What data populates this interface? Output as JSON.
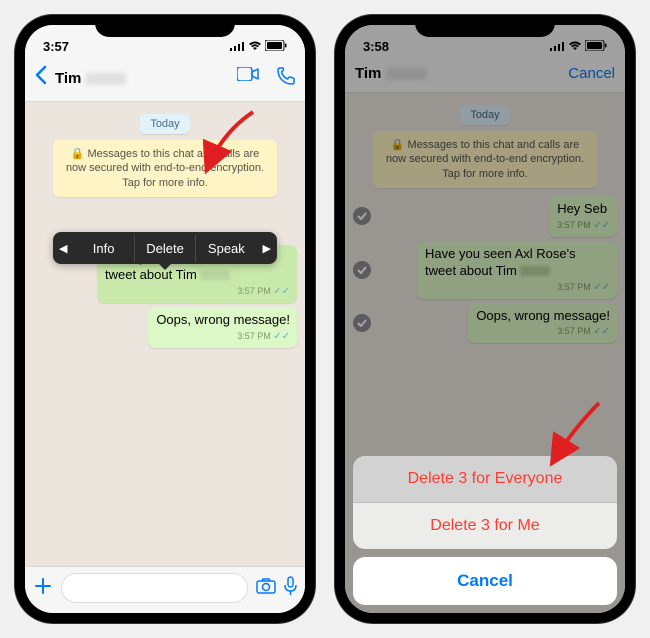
{
  "left": {
    "time": "3:57",
    "contact": "Tim",
    "date": "Today",
    "encryption": "🔒 Messages to this chat and calls are now secured with end-to-end encryption. Tap for more info.",
    "menu": {
      "info": "Info",
      "delete": "Delete",
      "speak": "Speak"
    },
    "messages": [
      {
        "text": "Have you seen Axl Rose's tweet about Tim",
        "time": "3:57 PM"
      },
      {
        "text": "Oops, wrong message!",
        "time": "3:57 PM"
      }
    ]
  },
  "right": {
    "time": "3:58",
    "contact": "Tim",
    "cancel": "Cancel",
    "date": "Today",
    "encryption": "🔒 Messages to this chat and calls are now secured with end-to-end encryption. Tap for more info.",
    "messages": [
      {
        "text": "Hey Seb",
        "time": "3:57 PM"
      },
      {
        "text": "Have you seen Axl Rose's tweet about Tim",
        "time": "3:57 PM"
      },
      {
        "text": "Oops, wrong message!",
        "time": "3:57 PM"
      }
    ],
    "sheet": {
      "deleteEveryone": "Delete 3 for Everyone",
      "deleteMe": "Delete 3 for Me",
      "cancel": "Cancel"
    }
  }
}
